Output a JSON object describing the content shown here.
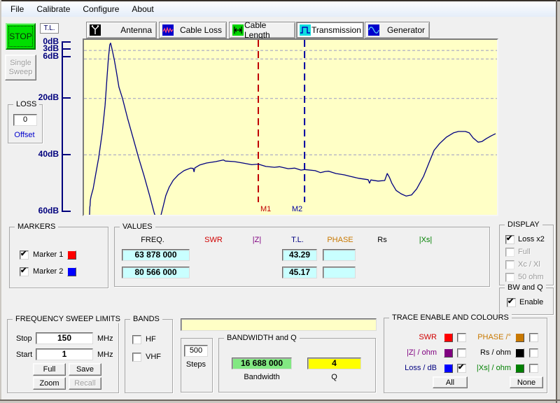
{
  "menu": {
    "items": [
      "File",
      "Calibrate",
      "Configure",
      "About"
    ]
  },
  "tabs": [
    {
      "label": "Antenna"
    },
    {
      "label": "Cable Loss"
    },
    {
      "label": "Cable Length"
    },
    {
      "label": "Transmission"
    },
    {
      "label": "Generator"
    }
  ],
  "left_panel": {
    "stop_label": "STOP",
    "single_sweep": {
      "line1": "Single",
      "line2": "Sweep"
    },
    "tl_label": "T.L.",
    "loss_group": {
      "title": "LOSS",
      "value": "0",
      "offset_label": "Offset"
    }
  },
  "axis": {
    "labels": [
      "0dB",
      "3dB",
      "6dB",
      "20dB",
      "40dB",
      "60dB"
    ]
  },
  "markers_group": {
    "title": "MARKERS",
    "items": [
      {
        "label": "Marker 1",
        "checked": true,
        "color": "#ff0000"
      },
      {
        "label": "Marker 2",
        "checked": true,
        "color": "#0000ff"
      }
    ]
  },
  "values_group": {
    "title": "VALUES",
    "headers": [
      {
        "label": "FREQ.",
        "color": "#000000"
      },
      {
        "label": "SWR",
        "color": "#d00000"
      },
      {
        "label": "|Z|",
        "color": "#800080"
      },
      {
        "label": "T.L.",
        "color": "#000080"
      },
      {
        "label": "PHASE",
        "color": "#c87800"
      },
      {
        "label": "Rs",
        "color": "#000000"
      },
      {
        "label": "|Xs|",
        "color": "#008000"
      }
    ],
    "rows": [
      {
        "freq": "63 878 000",
        "tl": "43.29",
        "phase": ""
      },
      {
        "freq": "80 566 000",
        "tl": "45.17",
        "phase": ""
      }
    ]
  },
  "display_group": {
    "title": "DISPLAY",
    "options": [
      {
        "label": "Loss x2",
        "checked": true,
        "enabled": true
      },
      {
        "label": "Full",
        "checked": false,
        "enabled": false
      },
      {
        "label": "Xc / Xl",
        "checked": false,
        "enabled": false
      },
      {
        "label": "50 ohm",
        "checked": false,
        "enabled": false
      }
    ]
  },
  "bwq_group": {
    "title": "BW and Q",
    "enable_label": "Enable",
    "enabled": true
  },
  "sweep_group": {
    "title": "FREQUENCY SWEEP LIMITS",
    "stop_label": "Stop",
    "stop_value": "150",
    "start_label": "Start",
    "start_value": "1",
    "unit": "MHz",
    "full_label": "Full",
    "save_label": "Save",
    "zoom_label": "Zoom",
    "recall_label": "Recall"
  },
  "bands_group": {
    "title": "BANDS",
    "options": [
      {
        "label": "HF",
        "checked": false
      },
      {
        "label": "VHF",
        "checked": false
      }
    ]
  },
  "steps_box": {
    "value": "500",
    "label": "Steps"
  },
  "bandwidth_group": {
    "title": "BANDWIDTH and Q",
    "bandwidth_value": "16 688 000",
    "bandwidth_label": "Bandwidth",
    "bandwidth_color": "#82e882",
    "q_value": "4",
    "q_label": "Q",
    "q_color": "#ffff00"
  },
  "trace_group": {
    "title": "TRACE ENABLE AND COLOURS",
    "all_label": "All",
    "none_label": "None",
    "items": [
      {
        "label": "SWR",
        "color": "#ff0000",
        "text_color": "#d00000",
        "checked": false
      },
      {
        "label": "PHASE /°",
        "color": "#c87800",
        "text_color": "#c87800",
        "checked": false
      },
      {
        "label": "|Z| / ohm",
        "color": "#800080",
        "text_color": "#800080",
        "checked": false
      },
      {
        "label": "Rs / ohm",
        "color": "#000000",
        "text_color": "#000000",
        "checked": false
      },
      {
        "label": "Loss / dB",
        "color": "#0000ff",
        "text_color": "#000080",
        "checked": true
      },
      {
        "label": "|Xs| / ohm",
        "color": "#008000",
        "text_color": "#008000",
        "checked": false
      }
    ]
  },
  "chart_data": {
    "type": "line",
    "title": "",
    "x_range": [
      1,
      150
    ],
    "x_unit": "MHz",
    "y_axis": {
      "unit": "dB",
      "ticks": [
        0,
        3,
        6,
        20,
        40,
        60
      ],
      "range": [
        0,
        60
      ],
      "inverted": true
    },
    "gridlines_db": [
      3,
      6,
      20,
      40
    ],
    "background": "#ffffc6",
    "grid_color": "#9a9ac4",
    "markers": [
      {
        "name": "M1",
        "freq_mhz": 63.878,
        "color": "#c00000",
        "label_side": "right"
      },
      {
        "name": "M2",
        "freq_mhz": 80.566,
        "color": "#0000a0",
        "label_side": "left"
      }
    ],
    "series": [
      {
        "name": "Loss / dB",
        "color": "#000080",
        "points": [
          [
            3.0,
            61.5
          ],
          [
            3.1,
            58.5
          ],
          [
            3.2,
            58.0
          ],
          [
            3.3,
            56.0
          ],
          [
            3.6,
            54.5
          ],
          [
            4.3,
            52.0
          ],
          [
            5.3,
            46.5
          ],
          [
            6.3,
            41.0
          ],
          [
            7.6,
            32.0
          ],
          [
            8.6,
            22.5
          ],
          [
            9.3,
            12.5
          ],
          [
            9.8,
            6.0
          ],
          [
            10.3,
            1.0
          ],
          [
            10.6,
            0.4
          ],
          [
            11.0,
            2.0
          ],
          [
            11.9,
            6.2
          ],
          [
            12.6,
            10.0
          ],
          [
            13.6,
            16.0
          ],
          [
            14.9,
            20.0
          ],
          [
            16.7,
            27.0
          ],
          [
            18.7,
            34.0
          ],
          [
            20.7,
            41.0
          ],
          [
            22.7,
            47.5
          ],
          [
            24.7,
            54.5
          ],
          [
            26.3,
            60.5
          ],
          [
            26.8,
            62.0
          ],
          [
            28.6,
            62.0
          ],
          [
            29.5,
            58.5
          ],
          [
            30.5,
            54.5
          ],
          [
            31.7,
            51.5
          ],
          [
            33.2,
            49.0
          ],
          [
            35.1,
            47.0
          ],
          [
            37.1,
            45.6
          ],
          [
            39.4,
            44.7
          ],
          [
            40.4,
            44.8
          ],
          [
            40.7,
            46.0
          ],
          [
            41.0,
            44.6
          ],
          [
            42.7,
            43.6
          ],
          [
            45.2,
            42.9
          ],
          [
            48.5,
            42.4
          ],
          [
            51.3,
            41.8
          ],
          [
            52.0,
            42.2
          ],
          [
            55.3,
            42.4
          ],
          [
            58.3,
            42.9
          ],
          [
            61.5,
            43.5
          ],
          [
            63.9,
            43.3
          ],
          [
            66.6,
            44.1
          ],
          [
            69.7,
            44.4
          ],
          [
            71.5,
            44.2
          ],
          [
            74.7,
            44.9
          ],
          [
            77.0,
            44.7
          ],
          [
            79.3,
            45.4
          ],
          [
            80.6,
            45.2
          ],
          [
            84.4,
            45.6
          ],
          [
            86.3,
            46.3
          ],
          [
            88.0,
            45.9
          ],
          [
            89.3,
            45.8
          ],
          [
            91.9,
            46.6
          ],
          [
            95.0,
            47.1
          ],
          [
            97.0,
            47.6
          ],
          [
            100.0,
            48.3
          ],
          [
            103.5,
            48.8
          ],
          [
            104.0,
            50.0
          ],
          [
            104.5,
            48.9
          ],
          [
            107.1,
            49.3
          ],
          [
            109.5,
            49.1
          ],
          [
            110.4,
            46.6
          ],
          [
            111.2,
            48.0
          ],
          [
            112.1,
            50.1
          ],
          [
            113.6,
            52.6
          ],
          [
            115.4,
            53.8
          ],
          [
            117.2,
            54.6
          ],
          [
            119.2,
            54.2
          ],
          [
            121.0,
            52.1
          ],
          [
            123.5,
            47.6
          ],
          [
            125.5,
            42.7
          ],
          [
            127.3,
            38.4
          ],
          [
            129.3,
            36.0
          ],
          [
            131.8,
            33.7
          ],
          [
            134.3,
            32.2
          ],
          [
            136.1,
            31.7
          ],
          [
            138.6,
            31.7
          ],
          [
            140.0,
            32.2
          ],
          [
            141.4,
            34.0
          ],
          [
            143.2,
            35.5
          ],
          [
            144.5,
            35.3
          ],
          [
            146.2,
            34.2
          ],
          [
            148.0,
            33.2
          ],
          [
            149.5,
            32.5
          ]
        ]
      }
    ]
  }
}
